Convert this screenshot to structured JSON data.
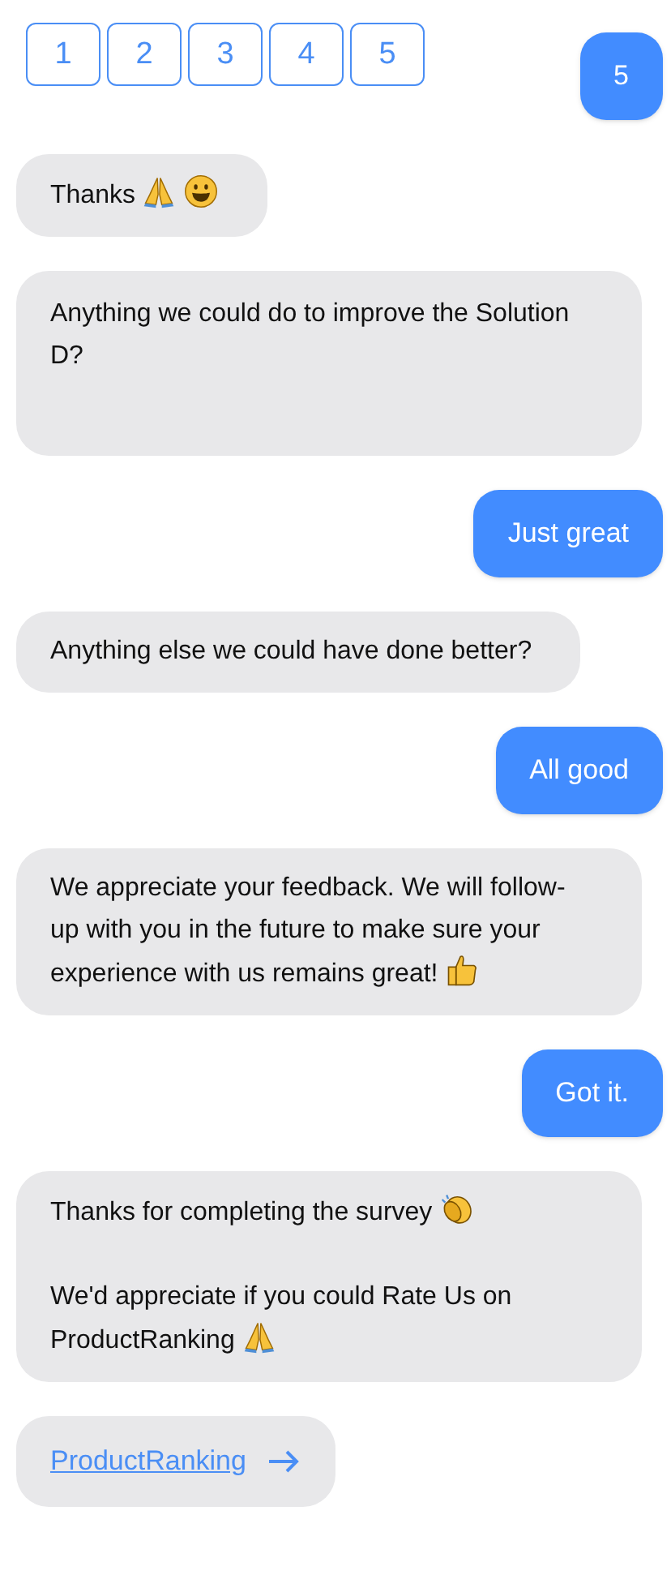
{
  "rating_options": [
    "1",
    "2",
    "3",
    "4",
    "5"
  ],
  "messages": [
    {
      "kind": "user",
      "paragraphs": [
        {
          "text": "5"
        }
      ]
    },
    {
      "kind": "bot",
      "paragraphs": [
        {
          "text": "Thanks",
          "emoji": [
            {
              "kind": "pray"
            },
            {
              "kind": "grin"
            }
          ]
        }
      ]
    },
    {
      "kind": "bot",
      "tall": true,
      "paragraphs": [
        {
          "text": "Anything we could do to improve the Solution D?"
        }
      ]
    },
    {
      "kind": "user",
      "paragraphs": [
        {
          "text": "Just great"
        }
      ]
    },
    {
      "kind": "bot",
      "paragraphs": [
        {
          "text": "Anything else we could have done better?"
        }
      ]
    },
    {
      "kind": "user",
      "paragraphs": [
        {
          "text": "All good"
        }
      ]
    },
    {
      "kind": "bot",
      "paragraphs": [
        {
          "text": "We appreciate your feedback. We will follow-up with you in the future to make sure your experience with us remains great!",
          "emoji": [
            {
              "kind": "thumbs-up"
            }
          ]
        }
      ]
    },
    {
      "kind": "user",
      "paragraphs": [
        {
          "text": "Got it."
        }
      ]
    },
    {
      "kind": "bot",
      "paragraphs": [
        {
          "text": "Thanks for completing the survey",
          "emoji": [
            {
              "kind": "clap"
            }
          ]
        },
        {
          "text": "We'd appreciate if you could Rate Us on ProductRanking",
          "emoji": [
            {
              "kind": "pray"
            }
          ]
        }
      ]
    }
  ],
  "link": {
    "label": "ProductRanking"
  }
}
